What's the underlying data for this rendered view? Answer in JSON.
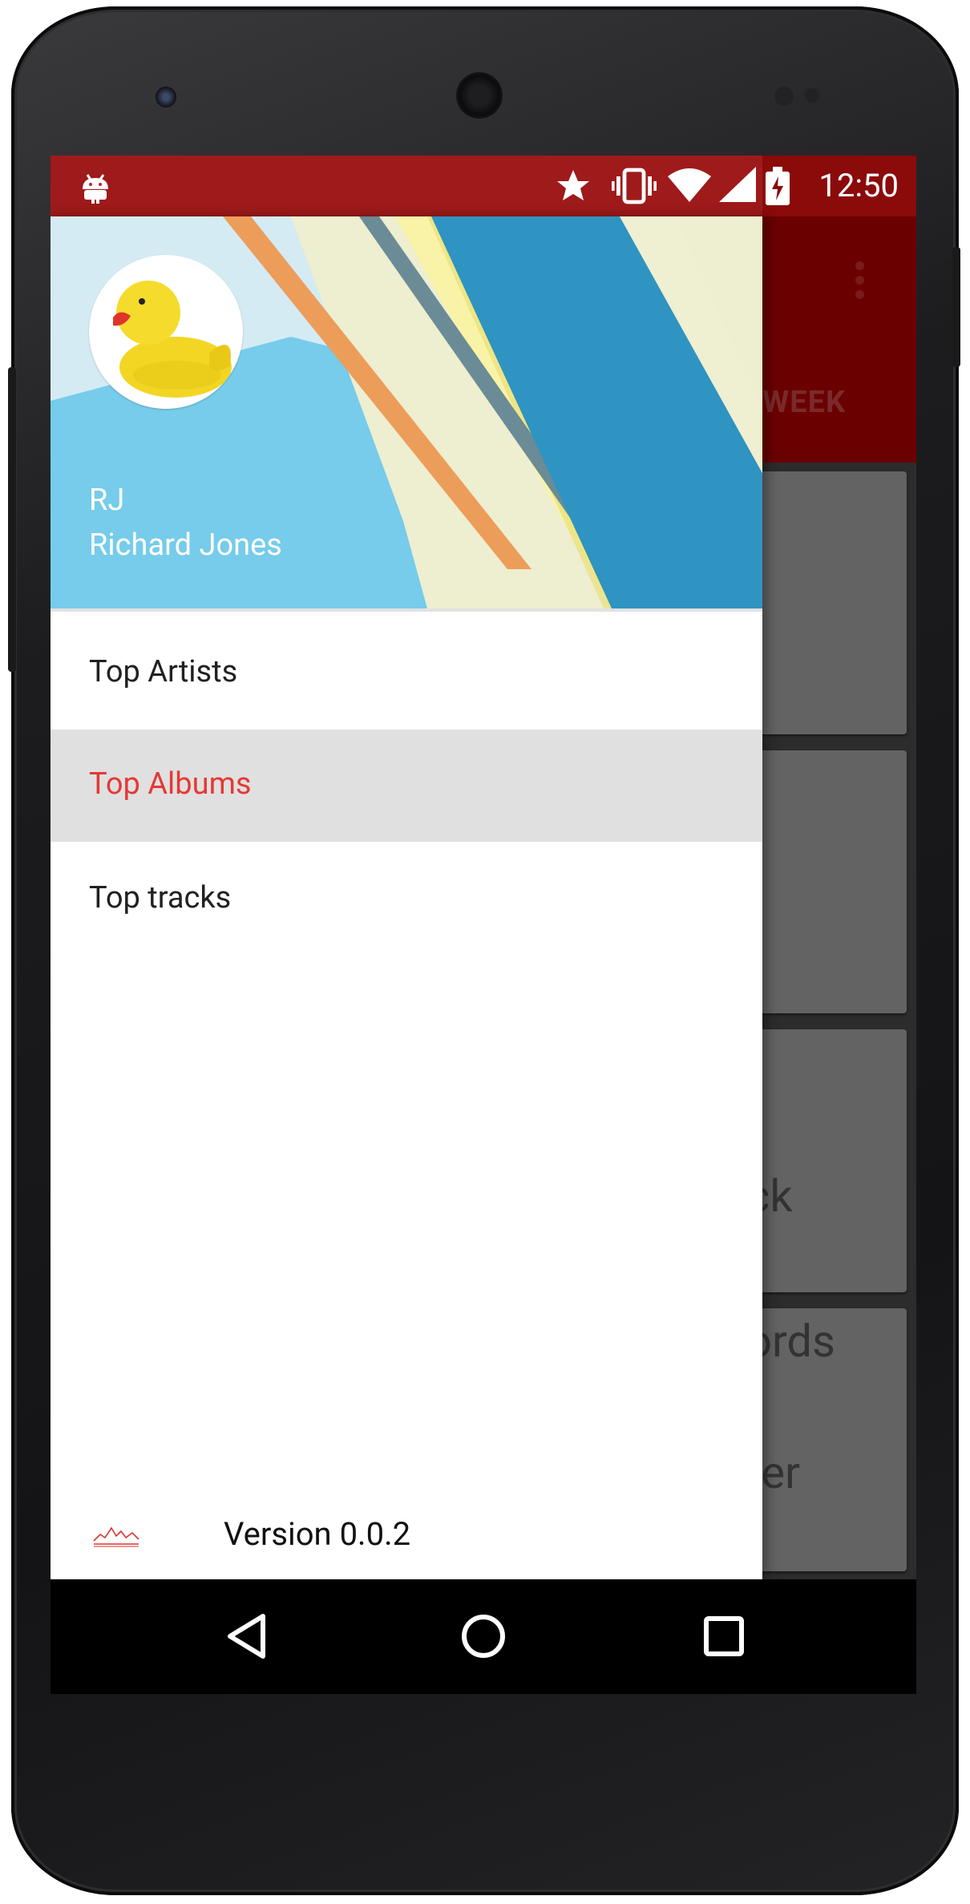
{
  "status_bar": {
    "time": "12:50",
    "icons": [
      "android-icon",
      "star-icon",
      "vibrate-icon",
      "wifi-icon",
      "signal-icon",
      "battery-charging-icon"
    ],
    "color": "#8b0a0a"
  },
  "background_app": {
    "tab_visible": "WEEK",
    "cards": [
      {
        "text": ""
      },
      {
        "text": ""
      },
      {
        "text": "ck"
      },
      {
        "text": "ords"
      },
      {
        "text": "ter"
      }
    ],
    "toolbar_color": "#6b0000"
  },
  "drawer": {
    "header": {
      "avatar": "rubber-duck-avatar",
      "initials": "RJ",
      "name": "Richard Jones"
    },
    "items": [
      {
        "label": "Top Artists",
        "active": false
      },
      {
        "label": "Top Albums",
        "active": true
      },
      {
        "label": "Top tracks",
        "active": false
      }
    ],
    "footer": {
      "logo": "last-stats-logo",
      "version": "Version 0.0.2"
    },
    "accent_color": "#e53935"
  },
  "nav_bar": {
    "buttons": [
      "back-icon",
      "home-icon",
      "recents-icon"
    ]
  }
}
